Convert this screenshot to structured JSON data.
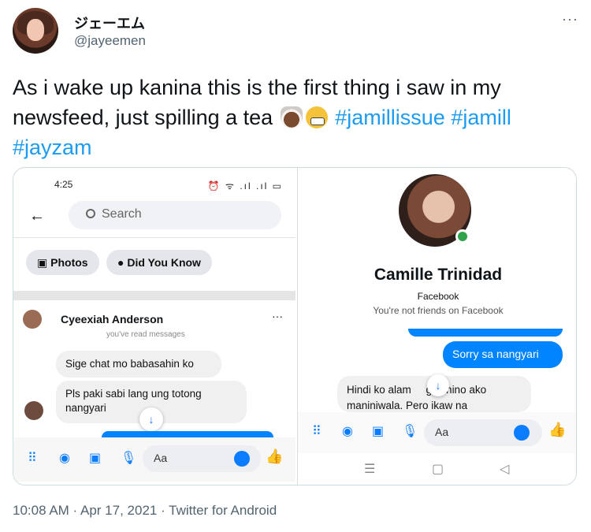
{
  "tweet": {
    "display_name": "ジェーエム",
    "handle": "@jayeemen",
    "more_label": "···",
    "text_main": "As i wake up kanina this is the first thing i saw in my newsfeed, just spilling a tea",
    "hashtags": [
      "#jamillissue",
      "#jamill",
      "#jayzam"
    ],
    "emoji_icons": [
      "hot-beverage-icon",
      "grimacing-face-icon"
    ],
    "timestamp": "10:08 AM · Apr 17, 2021 · Twitter for Android"
  },
  "left_screenshot": {
    "status_time": "4:25",
    "status_icons": "⏰ ᯤ .ıl .ıl ▭",
    "back_icon": "←",
    "search_placeholder": "Search",
    "chips": [
      "Photos",
      "Did You Know"
    ],
    "contact_name": "Cyeexiah Anderson",
    "contact_more": "···",
    "read_note": "you've read messages",
    "bubble_1": "Sige chat mo babasahin ko",
    "bubble_2": "Pls paki sabi lang ung totong nangyari",
    "scroll_icon": "↓",
    "composer_placeholder": "Aa",
    "thumb_icon": "👍"
  },
  "right_screenshot": {
    "profile_name": "Camille Trinidad",
    "profile_platform": "Facebook",
    "profile_status": "You're not friends on Facebook",
    "sent_bubble": "Sorry sa nangyari",
    "received_bubble": "Hindi ko alam     g kanino ako maniniwala. Pero ikaw na",
    "scroll_icon": "↓",
    "composer_placeholder": "Aa",
    "thumb_icon": "👍",
    "nav_icons": [
      "☰",
      "▢",
      "◁"
    ]
  },
  "colors": {
    "hashtag": "#1d9bf0",
    "messenger_blue": "#0084ff",
    "secondary_text": "#536471"
  }
}
